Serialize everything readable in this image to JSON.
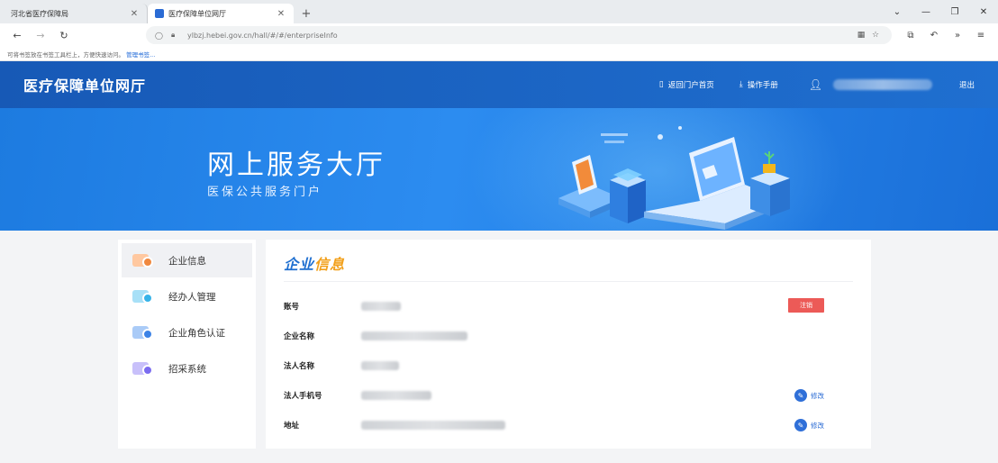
{
  "browser": {
    "tabs": [
      {
        "title": "河北省医疗保障局",
        "active": false
      },
      {
        "title": "医疗保障单位网厅",
        "active": true
      }
    ],
    "new_tab": "+",
    "url": "ylbzj.hebei.gov.cn/hall/#/#/enterpriseInfo",
    "bookmark_hint": "可将书签放在书签工具栏上，方便快速访问。",
    "bookmark_link": "管理书签..."
  },
  "site": {
    "logo": "医疗保障单位网厅",
    "nav": [
      {
        "label": "返回门户首页",
        "icon": "document-icon"
      },
      {
        "label": "操作手册",
        "icon": "download-icon"
      }
    ],
    "logout": "退出"
  },
  "banner": {
    "title": "网上服务大厅",
    "subtitle": "医保公共服务门户"
  },
  "sidebar": {
    "items": [
      {
        "label": "企业信息",
        "active": true,
        "color": "#f0883e"
      },
      {
        "label": "经办人管理",
        "active": false,
        "color": "#37b3e8"
      },
      {
        "label": "企业角色认证",
        "active": false,
        "color": "#3c83e6"
      },
      {
        "label": "招采系统",
        "active": false,
        "color": "#7b6cf0"
      }
    ]
  },
  "panel": {
    "title_main": "企业",
    "title_highlight": "信息",
    "rows": [
      {
        "label": "账号",
        "action": "注销"
      },
      {
        "label": "企业名称"
      },
      {
        "label": "法人名称"
      },
      {
        "label": "法人手机号",
        "action": "修改"
      },
      {
        "label": "地址",
        "action": "修改"
      }
    ]
  },
  "colors": {
    "header": "#1759b6",
    "banner": "#2c8cf0",
    "accent": "#1f6fd0",
    "danger": "#ec5a57"
  }
}
